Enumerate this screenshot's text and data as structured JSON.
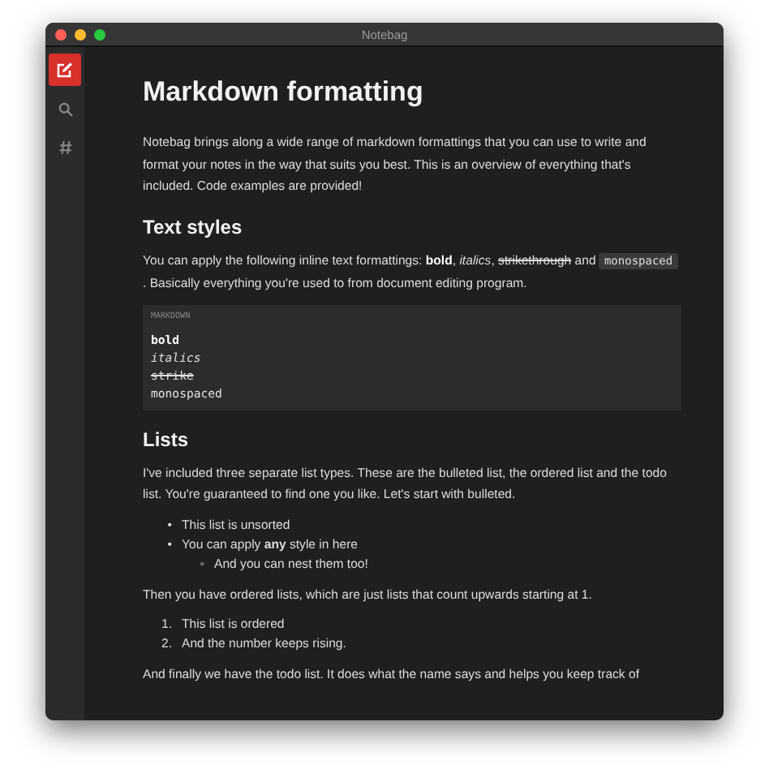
{
  "window": {
    "title": "Notebag"
  },
  "sidebar": {
    "items": [
      {
        "kind": "compose",
        "selected": true
      },
      {
        "kind": "search",
        "selected": false
      },
      {
        "kind": "tags",
        "selected": false
      }
    ]
  },
  "document": {
    "title": "Markdown formatting",
    "blocks": [
      {
        "kind": "paragraph",
        "segments": [
          {
            "kind": "plain",
            "text": "Notebag brings along a wide range of markdown formattings that you can use to write and format your notes in the way that suits you best. This is an overview of everything that's included. Code examples are provided!"
          }
        ]
      },
      {
        "kind": "heading",
        "text": "Text styles"
      },
      {
        "kind": "paragraph",
        "segments": [
          {
            "kind": "plain",
            "text": "You can apply the following inline text formattings: "
          },
          {
            "kind": "bold",
            "text": "bold"
          },
          {
            "kind": "plain",
            "text": ", "
          },
          {
            "kind": "italic",
            "text": "italics"
          },
          {
            "kind": "plain",
            "text": ", "
          },
          {
            "kind": "strike",
            "text": "strikethrough"
          },
          {
            "kind": "plain",
            "text": " and "
          },
          {
            "kind": "code",
            "text": "monospaced"
          },
          {
            "kind": "plain",
            "text": " . Basically everything you're used to from document editing program."
          }
        ]
      },
      {
        "kind": "code",
        "label": "MARKDOWN",
        "lines": [
          {
            "kind": "bold",
            "text": "bold"
          },
          {
            "kind": "italic",
            "text": "italics"
          },
          {
            "kind": "strike",
            "text": "strike"
          },
          {
            "kind": "plain",
            "text": "monospaced"
          }
        ]
      },
      {
        "kind": "heading",
        "text": "Lists"
      },
      {
        "kind": "paragraph",
        "segments": [
          {
            "kind": "plain",
            "text": "I've included three separate list types. These are the bulleted list, the ordered list and the todo list. You're guaranteed to find one you like. Let's start with bulleted."
          }
        ]
      },
      {
        "kind": "list",
        "items": [
          {
            "marker": "•",
            "text": "This list is unsorted"
          },
          {
            "marker": "•",
            "text": "You can apply **any** style in here",
            "children": [
              {
                "marker": "◦",
                "text": "And you can nest them too!"
              }
            ]
          }
        ]
      },
      {
        "kind": "paragraph",
        "segments": [
          {
            "kind": "plain",
            "text": "Then you have ordered lists, which are just lists that count upwards starting at 1."
          }
        ]
      },
      {
        "kind": "list",
        "items": [
          {
            "marker": "1.",
            "text": "This list is ordered"
          },
          {
            "marker": "2.",
            "text": "And the number keeps rising."
          }
        ]
      },
      {
        "kind": "paragraph",
        "segments": [
          {
            "kind": "plain",
            "text": "And finally we have the todo list. It does what the name says and helps you keep track of"
          }
        ]
      }
    ]
  }
}
